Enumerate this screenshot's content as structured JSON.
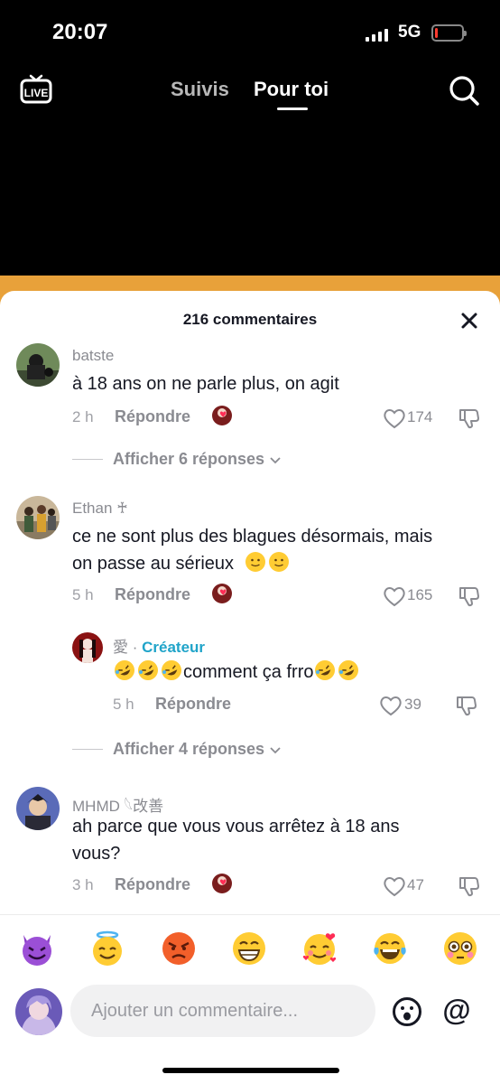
{
  "status_bar": {
    "time": "20:07",
    "network": "5G",
    "battery_level": 0.1,
    "battery_color": "#ff3b30"
  },
  "top_nav": {
    "live_icon": "live-tv-icon",
    "tab_following": "Suivis",
    "tab_for_you": "Pour toi",
    "search_icon": "search-icon"
  },
  "sheet": {
    "title": "216 commentaires"
  },
  "comments": [
    {
      "username": "batste",
      "text": "à 18 ans on ne parle plus, on agit",
      "time": "2 h",
      "reply": "Répondre",
      "likes": "174",
      "show_replies": "Afficher 6 réponses"
    },
    {
      "username": "Ethan ♰",
      "text_line1": "ce ne sont plus des blagues désormais, mais",
      "text_line2": "on passe au sérieux",
      "time": "5 h",
      "reply": "Répondre",
      "likes": "165",
      "reply_item": {
        "username": "愛",
        "separator": " · ",
        "creator_label": "Créateur",
        "text": "comment ça frro",
        "time": "5 h",
        "reply": "Répondre",
        "likes": "39"
      },
      "show_replies": "Afficher 4 réponses"
    },
    {
      "username": "MHMD 𓆩改善",
      "text_line1": "ah parce que vous vous arrêtez à 18 ans",
      "text_line2": "vous?",
      "time": "3 h",
      "reply": "Répondre",
      "likes": "47"
    }
  ],
  "emoji_bar": [
    "smiling-devil-emoji",
    "angel-emoji",
    "angry-emoji",
    "grinning-emoji",
    "hearts-face-emoji",
    "tears-of-joy-emoji",
    "flushed-emoji"
  ],
  "input": {
    "placeholder": "Ajouter un commentaire..."
  },
  "colors": {
    "accent_creator": "#20a4c9",
    "heart_badge": "#fe2c55",
    "video_bg": "#e8a13a"
  }
}
